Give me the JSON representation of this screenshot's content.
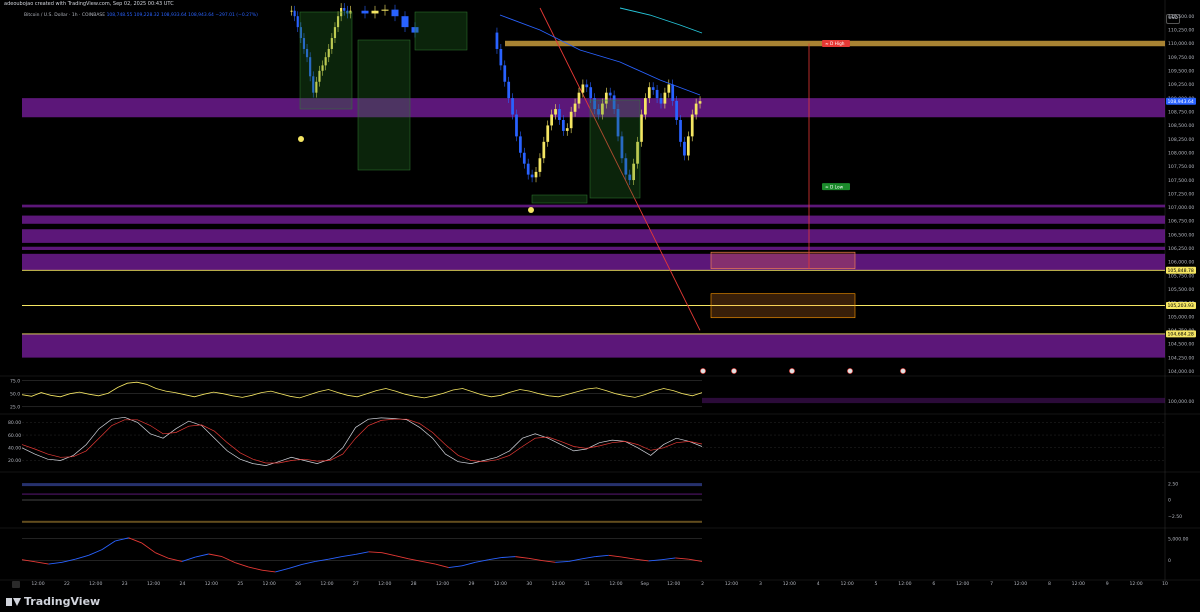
{
  "header": {
    "author_line": "adeoubojao created with TradingView.com, Sep 02, 2025 00:43 UTC",
    "symbol_line": "Bitcoin / U.S. Dollar · 1h · COINBASE",
    "ohlc": "108,748.55  109,228.32  108,933.64  108,943.64  −297.01 (−0.27%)"
  },
  "currency_button": "USD",
  "brand": "TradingView",
  "chart_data": [
    {
      "type": "candlestick",
      "name": "Bitcoin / U.S. Dollar · 1h · COINBASE",
      "y_ticks": [
        110500,
        110250,
        110000,
        109750,
        109500,
        109250,
        109000,
        108750,
        108500,
        108250,
        108000,
        107750,
        107500,
        107250,
        107000,
        106750,
        106500,
        106250,
        106000,
        105750,
        105500,
        105250,
        105000,
        104750,
        104500,
        104250,
        104000
      ],
      "y_tick_labels": [
        "110,500.00",
        "110,250.00",
        "110,000.00",
        "109,750.00",
        "109,500.00",
        "109,250.00",
        "109,000.00",
        "108,750.00",
        "108,500.00",
        "108,250.00",
        "108,000.00",
        "107,750.00",
        "107,500.00",
        "107,250.00",
        "107,000.00",
        "106,750.00",
        "106,500.00",
        "106,250.00",
        "106,000.00",
        "105,750.00",
        "105,500.00",
        "105,250.00",
        "105,000.00",
        "104,750.00",
        "104,500.00",
        "104,250.00",
        "104,000.00"
      ],
      "ylim": [
        103950,
        110650
      ],
      "price_labels": [
        {
          "value": 108943.64,
          "text": "108,943.64",
          "color": "#2962ff"
        },
        {
          "value": 105848.78,
          "text": "105,848.78",
          "color": "#f5e663"
        },
        {
          "value": 105203.93,
          "text": "105,203.93",
          "color": "#f5e663"
        },
        {
          "value": 104684.28,
          "text": "104,684.28",
          "color": "#f5e663"
        }
      ],
      "annotations": [
        {
          "text": "≈ D High",
          "value": 110000,
          "color": "#e53935"
        },
        {
          "text": "≈ D Low",
          "value": 107380,
          "color": "#1b8a2b"
        }
      ],
      "zones": [
        {
          "from": 109950,
          "to": 110050,
          "color": "#c69a3c"
        },
        {
          "from": 108650,
          "to": 109000,
          "color": "#7b1fa2"
        },
        {
          "from": 107000,
          "to": 107050,
          "color": "#7b1fa2"
        },
        {
          "from": 106700,
          "to": 106850,
          "color": "#7b1fa2"
        },
        {
          "from": 106350,
          "to": 106600,
          "color": "#7b1fa2"
        },
        {
          "from": 106220,
          "to": 106280,
          "color": "#7b1fa2"
        },
        {
          "from": 105850,
          "to": 106150,
          "color": "#7b1fa2"
        },
        {
          "from": 104250,
          "to": 104680,
          "color": "#7b1fa2"
        }
      ],
      "lines": [
        105848.78,
        105203.93,
        104684.28
      ],
      "candles_close": [
        110600,
        110500,
        110300,
        110100,
        109900,
        109750,
        109400,
        109100,
        109300,
        109500,
        109600,
        109750,
        109900,
        110100,
        110300,
        110500,
        110650,
        110600,
        110550,
        110600,
        110620,
        110500,
        110300,
        110200,
        109900,
        109600,
        109300,
        109000,
        108700,
        108300,
        108000,
        107800,
        107600,
        107550,
        107650,
        107900,
        108200,
        108500,
        108700,
        108800,
        108600,
        108400,
        108450,
        108750,
        108900,
        109100,
        109250,
        109200,
        109000,
        108800,
        108700,
        108900,
        109100,
        109050,
        108800,
        108300,
        107900,
        107600,
        107500,
        107800,
        108200,
        108700,
        109000,
        109200,
        109150,
        109000,
        108900,
        109100,
        109250,
        108950,
        108600,
        108200,
        107950,
        108300,
        108700,
        108900,
        108944
      ]
    },
    {
      "type": "line",
      "name": "RSI",
      "y_ticks": [
        75,
        50,
        25
      ],
      "y_tick_labels": [
        "75.0",
        "50.0",
        "25.0"
      ],
      "ylim": [
        15,
        80
      ],
      "values": [
        48,
        45,
        52,
        47,
        44,
        50,
        53,
        49,
        46,
        51,
        62,
        70,
        72,
        68,
        60,
        55,
        52,
        48,
        44,
        49,
        53,
        50,
        46,
        43,
        47,
        52,
        55,
        50,
        45,
        42,
        48,
        54,
        58,
        52,
        47,
        44,
        50,
        56,
        60,
        55,
        49,
        45,
        42,
        46,
        51,
        57,
        60,
        54,
        48,
        44,
        47,
        53,
        58,
        55,
        50,
        46,
        44,
        49,
        54,
        59,
        61,
        56,
        50,
        46,
        43,
        48,
        55,
        60,
        56,
        50,
        46,
        52
      ]
    },
    {
      "type": "line",
      "name": "Stochastic",
      "y_ticks": [
        80,
        60,
        40,
        20
      ],
      "y_tick_labels": [
        "80.00",
        "60.00",
        "40.00",
        "20.00"
      ],
      "ylim": [
        5,
        90
      ],
      "series": [
        {
          "color": "#d1d4dc",
          "values": [
            40,
            30,
            22,
            20,
            28,
            45,
            70,
            85,
            88,
            80,
            62,
            55,
            70,
            82,
            75,
            55,
            35,
            22,
            15,
            12,
            18,
            25,
            20,
            15,
            22,
            40,
            72,
            85,
            87,
            86,
            84,
            72,
            55,
            30,
            18,
            15,
            20,
            25,
            35,
            55,
            62,
            55,
            45,
            35,
            38,
            48,
            52,
            50,
            40,
            28,
            45,
            55,
            50,
            42
          ]
        },
        {
          "color": "#e53935",
          "values": [
            45,
            38,
            30,
            25,
            26,
            35,
            55,
            75,
            84,
            84,
            75,
            62,
            64,
            74,
            76,
            66,
            48,
            32,
            22,
            16,
            16,
            20,
            22,
            19,
            20,
            30,
            55,
            75,
            83,
            85,
            85,
            78,
            64,
            45,
            28,
            20,
            18,
            21,
            28,
            42,
            55,
            57,
            50,
            42,
            39,
            43,
            48,
            50,
            45,
            36,
            40,
            48,
            50,
            46
          ]
        }
      ]
    },
    {
      "type": "line",
      "name": "Oscillator",
      "y_ticks": [
        2.5,
        0,
        -2.5
      ],
      "y_tick_labels": [
        "2.50",
        "0",
        "−2.50"
      ],
      "ylim": [
        -4,
        4
      ]
    },
    {
      "type": "line",
      "name": "Momentum",
      "y_ticks": [
        5000,
        0
      ],
      "y_tick_labels": [
        "5,000.00",
        "0"
      ],
      "ylim": [
        -4000,
        7000
      ],
      "values": [
        200,
        -300,
        -800,
        -400,
        300,
        1200,
        2500,
        4500,
        5200,
        4000,
        1800,
        500,
        -200,
        800,
        1500,
        900,
        -500,
        -1500,
        -2200,
        -2600,
        -1800,
        -900,
        -200,
        300,
        900,
        1400,
        2000,
        1800,
        1100,
        400,
        -200,
        -800,
        -1600,
        -1200,
        -400,
        200,
        700,
        900,
        500,
        0,
        -400,
        -200,
        400,
        900,
        1200,
        800,
        300,
        -100,
        200,
        600,
        300,
        -200
      ]
    }
  ],
  "x_axis": {
    "labels": [
      "12:00",
      "22",
      "12:00",
      "23",
      "12:00",
      "24",
      "12:00",
      "25",
      "12:00",
      "26",
      "12:00",
      "27",
      "12:00",
      "28",
      "12:00",
      "29",
      "12:00",
      "30",
      "12:00",
      "31",
      "12:00",
      "Sep",
      "12:00",
      "2",
      "12:00",
      "3",
      "12:00",
      "4",
      "12:00",
      "5",
      "12:00",
      "6",
      "12:00",
      "7",
      "12:00",
      "8",
      "12:00",
      "9",
      "12:00",
      "10"
    ]
  },
  "colors": {
    "up": "#f5e663",
    "down": "#2962ff",
    "grid": "#1a1a1a",
    "axis_text": "#b2b5be",
    "purple": "#7b1fa2",
    "gold": "#c69a3c"
  }
}
